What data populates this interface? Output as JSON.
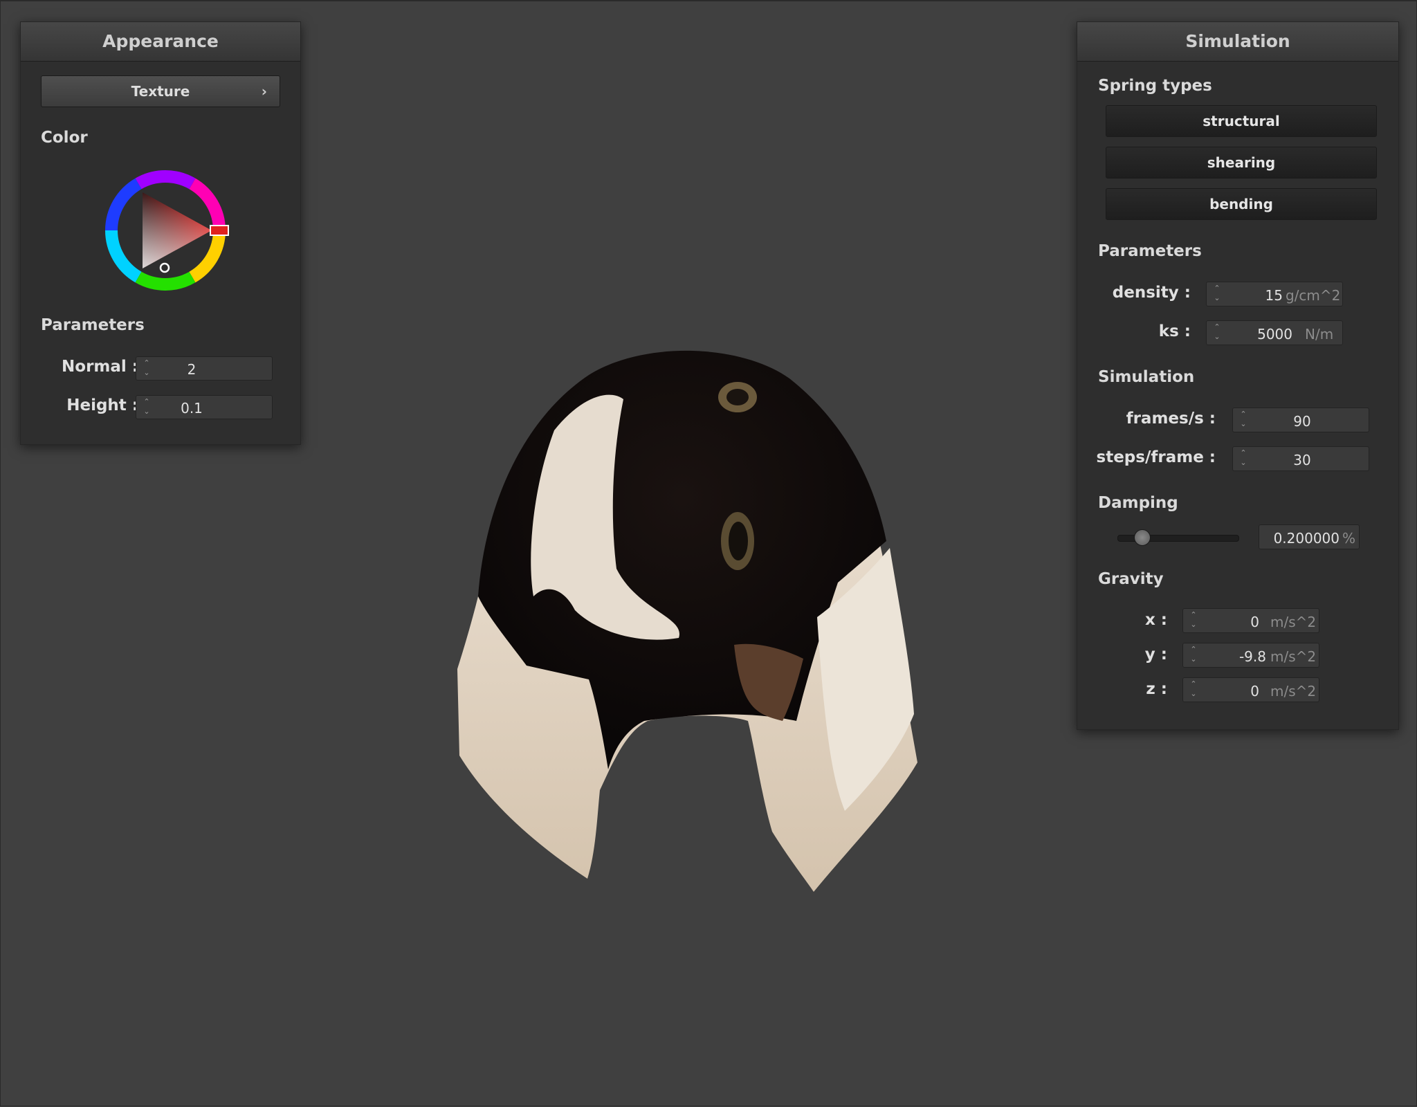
{
  "appearance": {
    "title": "Appearance",
    "texture_button": "Texture",
    "texture_chevron": "›",
    "color_label": "Color",
    "parameters_label": "Parameters",
    "normal": {
      "label": "Normal :",
      "value": "2"
    },
    "height": {
      "label": "Height :",
      "value": "0.1"
    },
    "selected_color": "#e0221f"
  },
  "simulation": {
    "title": "Simulation",
    "spring_types_label": "Spring types",
    "spring_buttons": [
      "structural",
      "shearing",
      "bending"
    ],
    "parameters_label": "Parameters",
    "density": {
      "label": "density :",
      "value": "15",
      "unit": "g/cm^2"
    },
    "ks": {
      "label": "ks :",
      "value": "5000",
      "unit": "N/m"
    },
    "simulation_label": "Simulation",
    "frames": {
      "label": "frames/s :",
      "value": "90"
    },
    "steps": {
      "label": "steps/frame :",
      "value": "30"
    },
    "damping_label": "Damping",
    "damping": {
      "value": "0.200000",
      "unit": "%",
      "slider_fraction": 0.2
    },
    "gravity_label": "Gravity",
    "gravity": [
      {
        "label": "x :",
        "value": "0",
        "unit": "m/s^2"
      },
      {
        "label": "y :",
        "value": "-9.8",
        "unit": "m/s^2"
      },
      {
        "label": "z :",
        "value": "0",
        "unit": "m/s^2"
      }
    ]
  },
  "viewport": {
    "object": "cloth draped over sphere"
  },
  "icons": {
    "spin_arrows": "spin-arrows-icon",
    "chevron": "chevron-right-icon"
  }
}
